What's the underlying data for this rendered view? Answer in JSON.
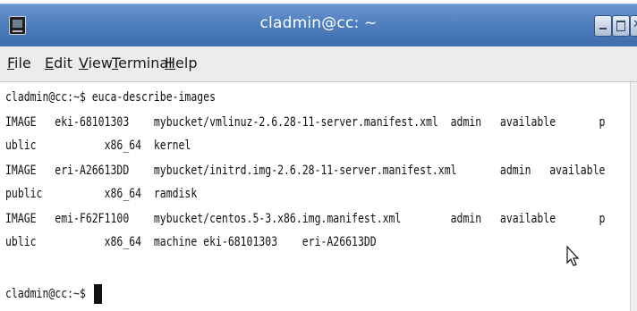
{
  "window": {
    "title": "cladmin@cc: ~"
  },
  "menu": {
    "items": [
      "File",
      "Edit",
      "View",
      "Terminal",
      "Help"
    ]
  },
  "terminal": {
    "lines": [
      "cladmin@cc:~$ euca-describe-images",
      "IMAGE   eki-68101303    mybucket/vmlinuz-2.6.28-11-server.manifest.xml  admin   available       p",
      "ublic           x86_64  kernel",
      "IMAGE   eri-A26613DD    mybucket/initrd.img-2.6.28-11-server.manifest.xml       admin   available",
      "public          x86_64  ramdisk",
      "IMAGE   emi-F62F1100    mybucket/centos.5-3.x86.img.manifest.xml        admin   available       p",
      "ublic           x86_64  machine eki-68101303    eri-A26613DD",
      "cladmin@cc:~$ "
    ]
  }
}
